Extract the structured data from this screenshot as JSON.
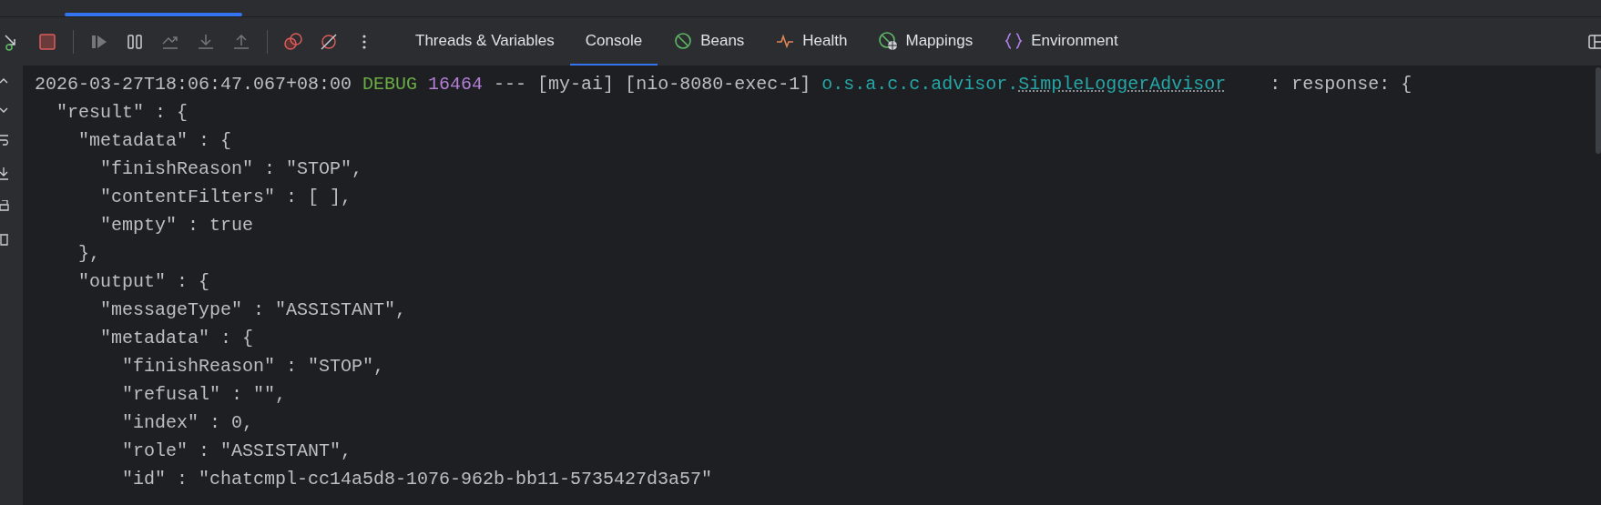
{
  "top_tab": {
    "selected": true
  },
  "toolbar": [
    {
      "kind": "rerun",
      "disabled": false
    },
    {
      "kind": "stop",
      "disabled": false
    },
    {
      "kind": "resume",
      "disabled": true
    },
    {
      "kind": "pause",
      "disabled": false
    },
    {
      "kind": "step-over",
      "disabled": true
    },
    {
      "kind": "step-into",
      "disabled": true
    },
    {
      "kind": "step-out",
      "disabled": true
    },
    {
      "kind": "breakpoints",
      "disabled": false
    },
    {
      "kind": "mute",
      "disabled": false
    },
    {
      "kind": "more",
      "disabled": false
    }
  ],
  "tabs": [
    {
      "label": "Threads & Variables",
      "kind": "plain",
      "selected": false
    },
    {
      "label": "Console",
      "kind": "plain",
      "selected": true
    },
    {
      "label": "Beans",
      "kind": "beans",
      "selected": false
    },
    {
      "label": "Health",
      "kind": "health",
      "selected": false
    },
    {
      "label": "Mappings",
      "kind": "mappings",
      "selected": false
    },
    {
      "label": "Environment",
      "kind": "environment",
      "selected": false
    }
  ],
  "log_header": {
    "timestamp": "2026-03-27T18:06:47.067+08:00",
    "level": "DEBUG",
    "pid": "16464",
    "separator": "---",
    "app": "[my-ai]",
    "thread": "[nio-8080-exec-1]",
    "logger_package": "o.s.a.c.c.advisor.",
    "logger_class": "SimpleLoggerAdvisor",
    "message": ": response: {"
  },
  "lines": [
    "  \"result\" : {",
    "    \"metadata\" : {",
    "      \"finishReason\" : \"STOP\",",
    "      \"contentFilters\" : [ ],",
    "      \"empty\" : true",
    "    },",
    "    \"output\" : {",
    "      \"messageType\" : \"ASSISTANT\",",
    "      \"metadata\" : {",
    "        \"finishReason\" : \"STOP\",",
    "        \"refusal\" : \"\",",
    "        \"index\" : 0,",
    "        \"role\" : \"ASSISTANT\",",
    "        \"id\" : \"chatcmpl-cc14a5d8-1076-962b-bb11-5735427d3a57\""
  ]
}
